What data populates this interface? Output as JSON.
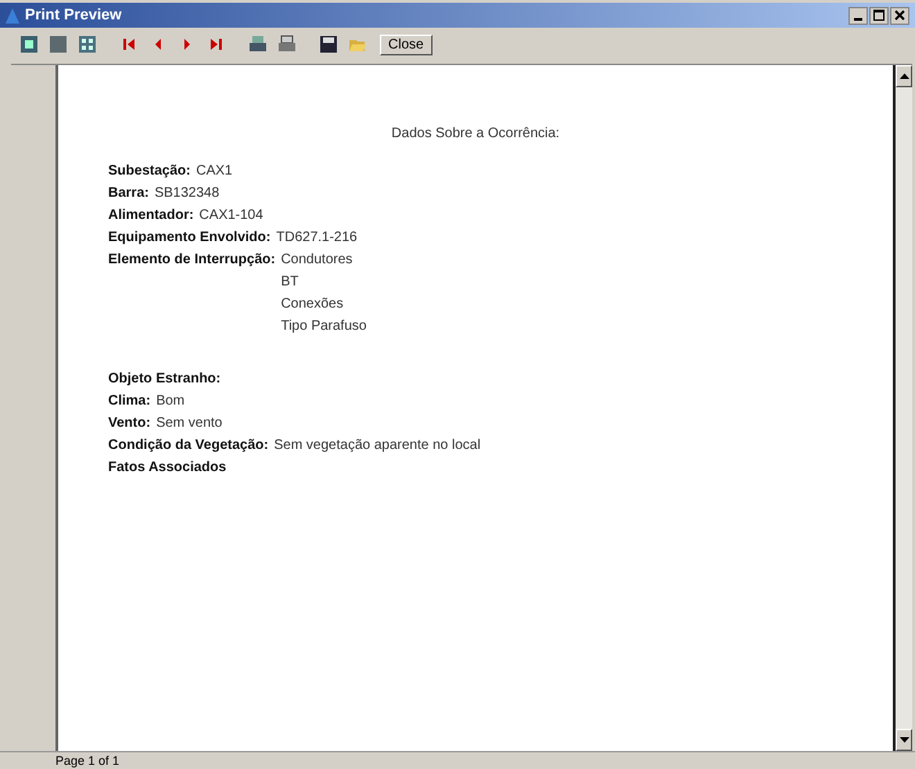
{
  "window": {
    "title": "Print Preview"
  },
  "toolbar": {
    "close_label": "Close"
  },
  "page": {
    "heading": "Dados Sobre a Ocorrência:",
    "groups": [
      {
        "fields": [
          {
            "label": "Subestação:",
            "values": [
              "CAX1"
            ]
          },
          {
            "label": "Barra:",
            "values": [
              "SB132348"
            ]
          },
          {
            "label": "Alimentador:",
            "values": [
              "CAX1-104"
            ]
          },
          {
            "label": "Equipamento Envolvido:",
            "values": [
              "TD627.1-216"
            ]
          },
          {
            "label": "Elemento de Interrupção:",
            "values": [
              "Condutores",
              "BT",
              "Conexões",
              "Tipo Parafuso"
            ]
          }
        ]
      },
      {
        "fields": [
          {
            "label": "Objeto Estranho:"
          },
          {
            "label": "Clima:",
            "values": [
              "Bom"
            ]
          },
          {
            "label": "Vento:",
            "values": [
              "Sem vento"
            ]
          },
          {
            "label": "Condição da Vegetação:",
            "values": [
              "Sem vegetação aparente no local"
            ]
          },
          {
            "label": "Fatos Associados"
          }
        ]
      }
    ]
  },
  "status_bar": {
    "text": "Page 1 of 1"
  }
}
